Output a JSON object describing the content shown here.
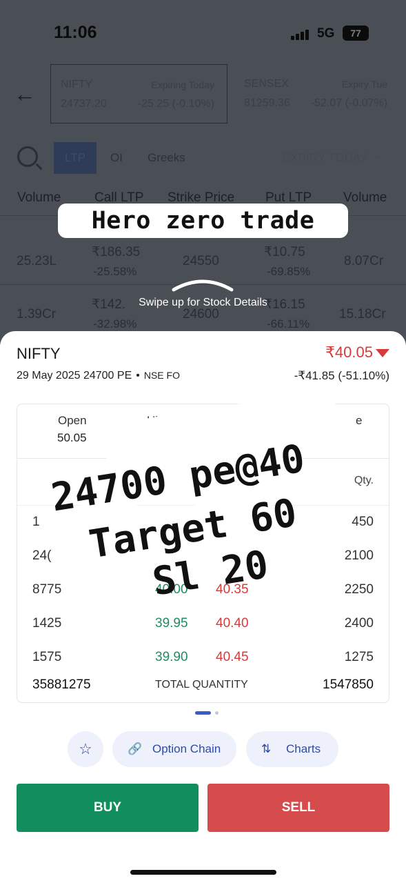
{
  "status": {
    "time": "11:06",
    "network": "5G",
    "battery": "77"
  },
  "index_cards": [
    {
      "name": "NIFTY",
      "expiry": "Expiring Today",
      "value": "24737.20",
      "change": "-25.25 (-0.10%)"
    },
    {
      "name": "SENSEX",
      "expiry": "Expiry Tue",
      "value": "81259.36",
      "change": "-52.07 (-0.07%)"
    }
  ],
  "chain": {
    "tabs": [
      "LTP",
      "OI",
      "Greeks"
    ],
    "expiry_label": "EXPIRY TODAY",
    "columns": [
      "Volume",
      "Call LTP",
      "Strike Price",
      "Put LTP",
      "Volume"
    ],
    "rows": [
      {
        "call_vol": "25.23L",
        "call_ltp": "₹186.35",
        "call_chg": "-25.58%",
        "strike": "24550",
        "put_ltp": "₹10.75",
        "put_chg": "-69.85%",
        "put_vol": "8.07Cr"
      },
      {
        "call_vol": "1.39Cr",
        "call_ltp": "₹142.",
        "call_chg": "-32.98%",
        "strike": "24600",
        "put_ltp": "₹16.15",
        "put_chg": "-66.11%",
        "put_vol": "15.18Cr"
      }
    ]
  },
  "overlay_badge": "Hero zero trade",
  "swipe_hint": "Swipe up for Stock Details",
  "instrument": {
    "symbol": "NIFTY",
    "contract": "29 May 2025 24700 PE",
    "exchange": "NSE FO",
    "price": "₹40.05",
    "change": "-₹41.85  (-51.10%)",
    "trend_color": "#d63b3b"
  },
  "ohlc": {
    "open_label": "Open",
    "open_value": "50.05",
    "high_label": "High",
    "high_value": "5",
    "close_label": "e"
  },
  "depth": {
    "qty_header": "Qty.",
    "rows": [
      {
        "bid_qty": "1",
        "bid": "",
        "ask": "",
        "ask_qty": "450"
      },
      {
        "bid_qty": "24(",
        "bid": "",
        "ask": "",
        "ask_qty": "2100"
      },
      {
        "bid_qty": "8775",
        "bid": "40.00",
        "ask": "40.35",
        "ask_qty": "2250"
      },
      {
        "bid_qty": "1425",
        "bid": "39.95",
        "ask": "40.40",
        "ask_qty": "2400"
      },
      {
        "bid_qty": "1575",
        "bid": "39.90",
        "ask": "40.45",
        "ask_qty": "1275"
      }
    ],
    "total_bid": "35881275",
    "total_label": "TOTAL QUANTITY",
    "total_ask": "1547850"
  },
  "trade_note": {
    "line1": "24700 pe@40",
    "line2": "Target 60",
    "line3": "Sl 20"
  },
  "actions": {
    "watchlist_icon": "star-plus-icon",
    "option_chain": "Option Chain",
    "charts": "Charts"
  },
  "buttons": {
    "buy": "BUY",
    "sell": "SELL"
  }
}
